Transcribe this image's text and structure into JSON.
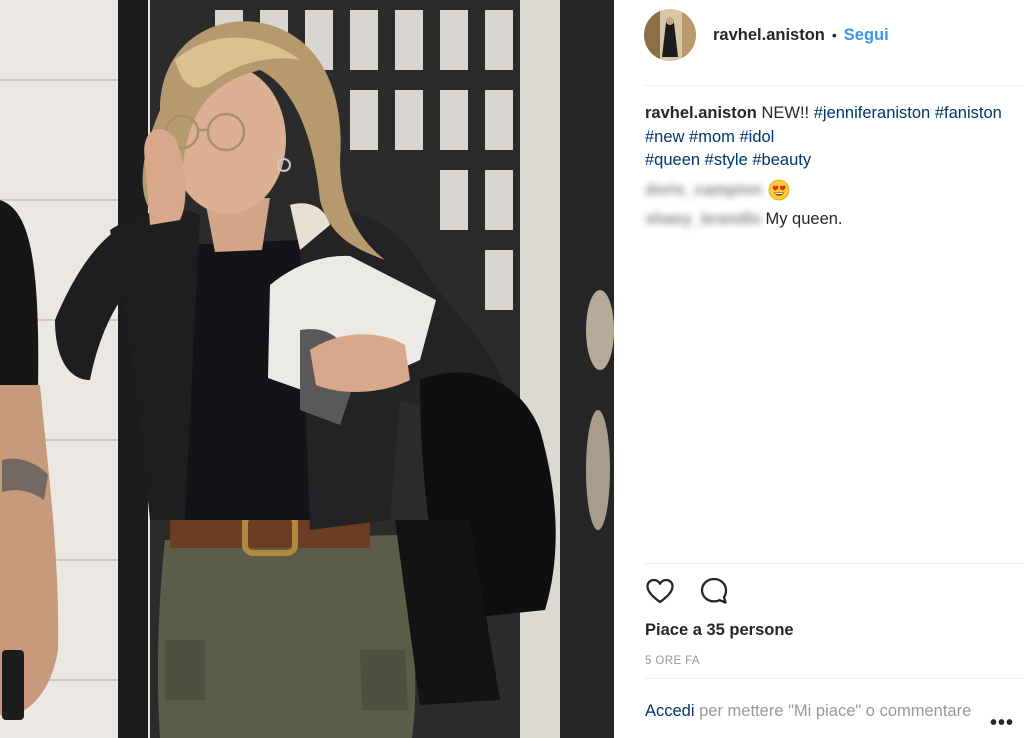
{
  "header": {
    "username": "ravhel.aniston",
    "separator": "•",
    "follow_label": "Segui"
  },
  "caption": {
    "username": "ravhel.aniston",
    "text": "NEW!!",
    "hashtags": [
      "#jenniferaniston",
      "#faniston",
      "#new",
      "#mom",
      "#idol",
      "#queen",
      "#style",
      "#beauty"
    ]
  },
  "comments": [
    {
      "username": "doris_campion",
      "text": "",
      "emoji": "heart-eyes"
    },
    {
      "username": "shaey_brandlo",
      "text": "My queen."
    }
  ],
  "actions": {
    "like_icon": "heart-outline-icon",
    "comment_icon": "comment-bubble-icon"
  },
  "likes_text": "Piace a 35 persone",
  "time_text": "5 ORE FA",
  "login_prompt": {
    "link": "Accedi",
    "rest": " per mettere \"Mi piace\" o commentare"
  },
  "more_label": "•••",
  "colors": {
    "link": "#003569",
    "follow": "#3897f0",
    "muted": "#999999",
    "text": "#262626"
  }
}
